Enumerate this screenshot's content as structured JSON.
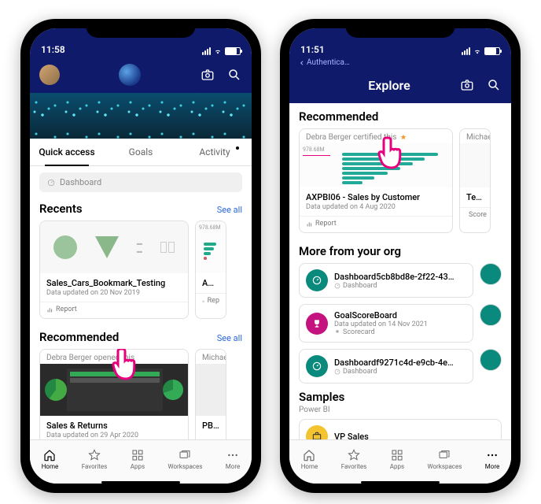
{
  "phoneA": {
    "time": "11:58",
    "tabs": {
      "quick": "Quick access",
      "goals": "Goals",
      "activity": "Activity"
    },
    "pill_dashboard": "Dashboard",
    "sections": {
      "recents": {
        "title": "Recents",
        "see_all": "See all"
      },
      "recommended": {
        "title": "Recommended",
        "see_all": "See all"
      }
    },
    "recents_card": {
      "title": "Sales_Cars_Bookmark_Testing",
      "subtitle": "Data updated on 20 Nov 2019",
      "type": "Report"
    },
    "recents_peek": {
      "axis_label": "978.68M",
      "title_peek": "AXPB",
      "type_peek": "Rep"
    },
    "recommended_card": {
      "opened_by": "Debra Berger opened this",
      "title": "Sales & Returns",
      "subtitle": "Data updated on 29 Apr 2020",
      "type": "Report"
    },
    "recommended_peek": {
      "name_peek": "Michae",
      "title_peek": "PBIM"
    }
  },
  "phoneB": {
    "time": "11:51",
    "breadcrumb": "Authentica…",
    "topbar_title": "Explore",
    "recommended": {
      "title": "Recommended",
      "certified_by": "Debra Berger certified this",
      "axis_label": "978.68M",
      "card_title": "AXPBI06 - Sales by Customer",
      "card_subtitle": "Data updated on 4 Aug 2020",
      "card_type": "Report",
      "peek_name": "Michael",
      "peek_title": "Testing",
      "peek_type": "Score"
    },
    "more_org": {
      "title": "More from your org",
      "items": [
        {
          "title": "Dashboard5cb8bd8e-2f22-43…",
          "sub": "Dashboard",
          "color": "teal",
          "icon": "gauge"
        },
        {
          "title": "GoalScoreBoard",
          "sub": "Data updated on 14 Nov 2021",
          "sub2": "Scorecard",
          "color": "magenta",
          "icon": "trophy"
        },
        {
          "title": "Dashboardf9271c4d-e9cb-4e…",
          "sub": "Dashboard",
          "color": "teal",
          "icon": "gauge"
        }
      ]
    },
    "samples": {
      "title": "Samples",
      "sub_label": "Power BI",
      "item_title": "VP Sales"
    }
  },
  "nav": {
    "home": "Home",
    "favorites": "Favorites",
    "apps": "Apps",
    "workspaces": "Workspaces",
    "more": "More"
  },
  "icons": {
    "report": "Report",
    "dashboard": "Dashboard",
    "scorecard": "Scorecard"
  }
}
